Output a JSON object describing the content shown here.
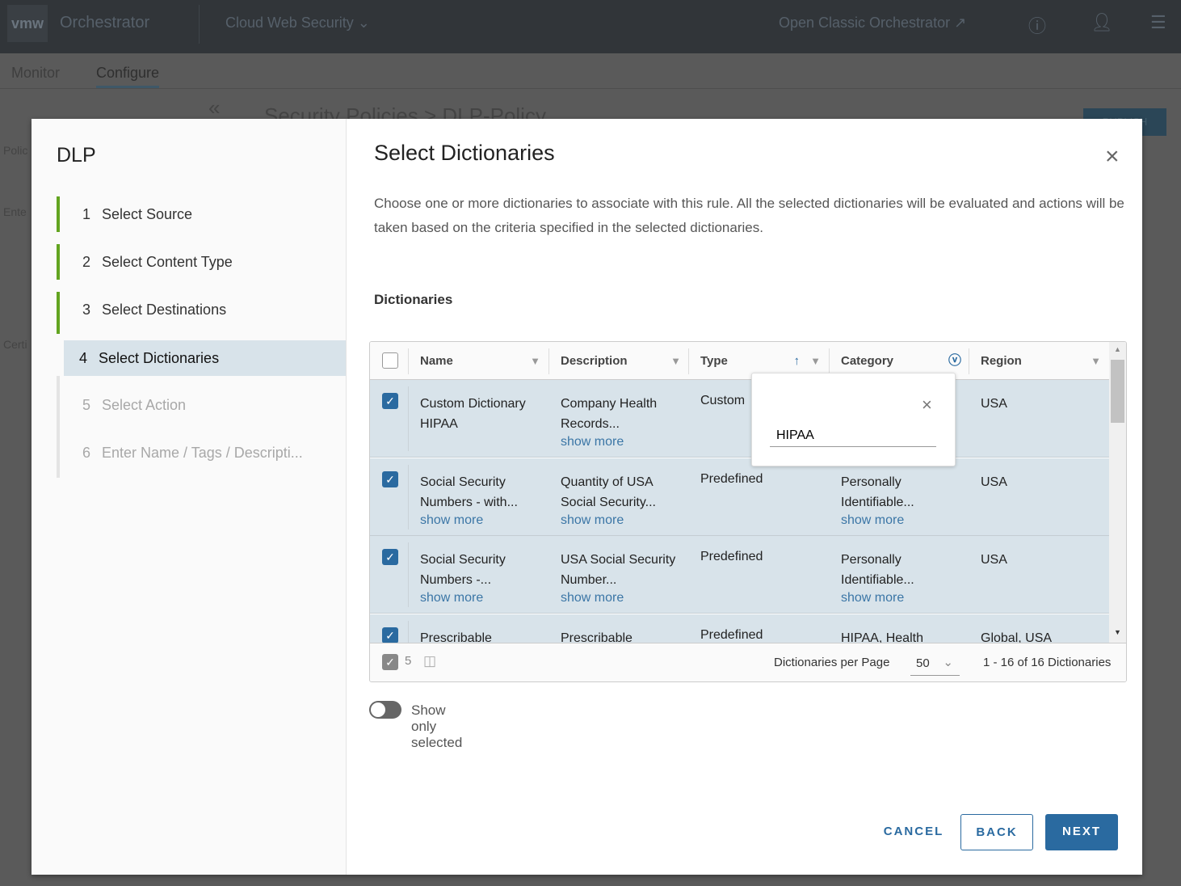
{
  "topbar": {
    "logo": "vmw",
    "app": "Orchestrator",
    "context": "Cloud Web Security",
    "classic": "Open Classic Orchestrator"
  },
  "background": {
    "tabs": [
      "Monitor",
      "Configure"
    ],
    "breadcrumb": "Security Policies > DLP-Policy",
    "publish": "PUBLISH",
    "sidebar_fragments": [
      "Polic",
      "Ente",
      "Certi"
    ]
  },
  "wizard": {
    "title": "DLP",
    "steps": [
      {
        "num": "1",
        "label": "Select Source",
        "state": "done"
      },
      {
        "num": "2",
        "label": "Select Content Type",
        "state": "done"
      },
      {
        "num": "3",
        "label": "Select Destinations",
        "state": "done"
      },
      {
        "num": "4",
        "label": "Select Dictionaries",
        "state": "current"
      },
      {
        "num": "5",
        "label": "Select Action",
        "state": "disabled"
      },
      {
        "num": "6",
        "label": "Enter Name / Tags / Descripti...",
        "state": "disabled"
      }
    ]
  },
  "main": {
    "title": "Select Dictionaries",
    "description": "Choose one or more dictionaries to associate with this rule. All the selected dictionaries will be evaluated and actions will be taken based on the criteria specified in the selected dictionaries.",
    "section": "Dictionaries"
  },
  "grid": {
    "columns": [
      "Name",
      "Description",
      "Type",
      "Category",
      "Region"
    ],
    "rows": [
      {
        "name": "Custom Dictionary HIPAA",
        "name_more": false,
        "desc": "Company Health Records...",
        "desc_more": true,
        "type": "Custom",
        "category": "",
        "cat_more": false,
        "region": "USA",
        "checked": true
      },
      {
        "name": "Social Security Numbers - with...",
        "name_more": true,
        "desc": "Quantity of USA Social Security...",
        "desc_more": true,
        "type": "Predefined",
        "category": "Personally Identifiable...",
        "cat_more": true,
        "region": "USA",
        "checked": true
      },
      {
        "name": "Social Security Numbers -...",
        "name_more": true,
        "desc": "USA Social Security Number...",
        "desc_more": true,
        "type": "Predefined",
        "category": "Personally Identifiable...",
        "cat_more": true,
        "region": "USA",
        "checked": true
      },
      {
        "name": "Prescribable",
        "name_more": false,
        "desc": "Prescribable",
        "desc_more": false,
        "type": "Predefined",
        "category": "HIPAA, Health",
        "cat_more": false,
        "region": "Global, USA",
        "checked": true
      }
    ],
    "show_more": "show more",
    "filter_value": "HIPAA",
    "selected_count": "5",
    "per_page_label": "Dictionaries per Page",
    "per_page": "50",
    "range": "1 - 16 of 16 Dictionaries"
  },
  "toggle": {
    "label": "Show only selected",
    "on": false
  },
  "buttons": {
    "cancel": "CANCEL",
    "back": "BACK",
    "next": "NEXT"
  },
  "colors": {
    "accent": "#2a6aa0",
    "step_done": "#62a420",
    "row_selected": "#d8e3ea"
  }
}
